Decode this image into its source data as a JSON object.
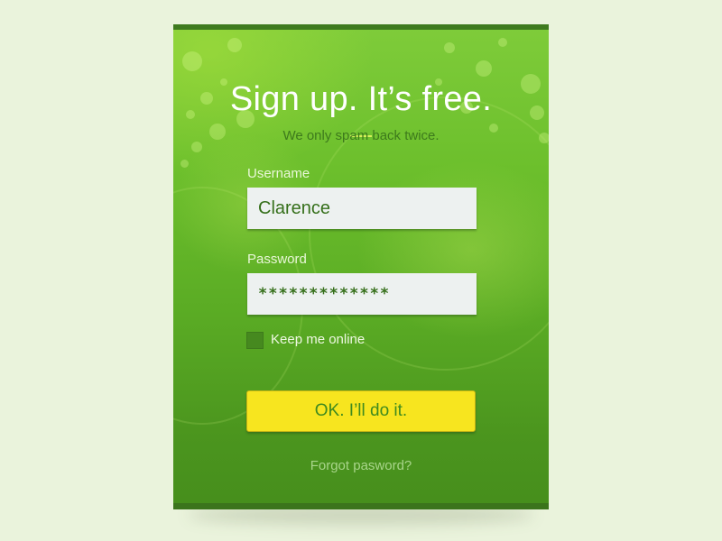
{
  "form": {
    "title": "Sign up. It’s free.",
    "subtitle": "We only spam back twice.",
    "username_label": "Username",
    "username_value": "Clarence",
    "password_label": "Password",
    "password_value": "*************",
    "keep_online_label": "Keep me online",
    "keep_online_checked": false,
    "submit_label": "OK. I’ll do it.",
    "forgot_label": "Forgot pasword?"
  },
  "colors": {
    "page_background": "#eaf3dc",
    "card_green": "#5aab24",
    "card_border": "#3e7a1e",
    "button_yellow": "#f7e51f",
    "text_green": "#3d7a1c"
  }
}
